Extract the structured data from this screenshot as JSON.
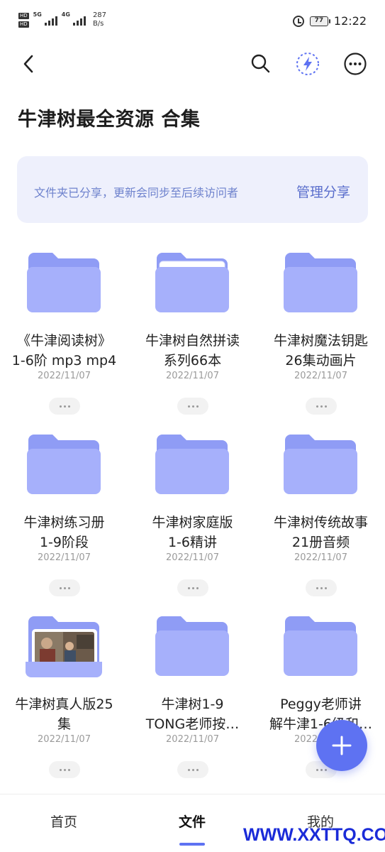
{
  "status_bar": {
    "net_1": "5G",
    "net_2": "4G",
    "speed_value": "287",
    "speed_unit": "B/s",
    "battery": "77",
    "time": "12:22"
  },
  "topbar": {
    "back_icon": "chevron-left-icon",
    "search_icon": "search-icon",
    "flash_icon": "lightning-icon",
    "more_icon": "more-horizontal-icon"
  },
  "page_title": "牛津树最全资源 合集",
  "share_banner": {
    "text": "文件夹已分享，更新会同步至后续访问者",
    "action": "管理分享"
  },
  "folders": [
    {
      "line1": "《牛津阅读树》",
      "line2": "1-6阶 mp3 mp4",
      "date": "2022/11/07",
      "variant": "plain"
    },
    {
      "line1": "牛津树自然拼读",
      "line2": "系列66本",
      "date": "2022/11/07",
      "variant": "paper"
    },
    {
      "line1": "牛津树魔法钥匙",
      "line2": "26集动画片",
      "date": "2022/11/07",
      "variant": "plain"
    },
    {
      "line1": "牛津树练习册",
      "line2": "1-9阶段",
      "date": "2022/11/07",
      "variant": "plain"
    },
    {
      "line1": "牛津树家庭版",
      "line2": "1-6精讲",
      "date": "2022/11/07",
      "variant": "plain"
    },
    {
      "line1": "牛津树传统故事",
      "line2": "21册音频",
      "date": "2022/11/07",
      "variant": "plain"
    },
    {
      "line1": "牛津树真人版25",
      "line2": "集",
      "date": "2022/11/07",
      "variant": "photo"
    },
    {
      "line1": "牛津树1-9",
      "line2": "TONG老师按…",
      "date": "2022/11/07",
      "variant": "plain"
    },
    {
      "line1": "Peggy老师讲",
      "line2": "解牛津1-6级和…",
      "date": "2022/11/07",
      "variant": "plain"
    }
  ],
  "fab_icon": "plus-icon",
  "bottom_nav": {
    "home": "首页",
    "files": "文件",
    "mine": "我的"
  },
  "watermark": "WWW.XXTTQ.COM",
  "colors": {
    "accent": "#5e72f2",
    "folder_back": "#8f9cf5",
    "folder_front": "#a6b0fb",
    "banner_bg": "#eef0fc",
    "banner_text": "#6e82cd"
  }
}
